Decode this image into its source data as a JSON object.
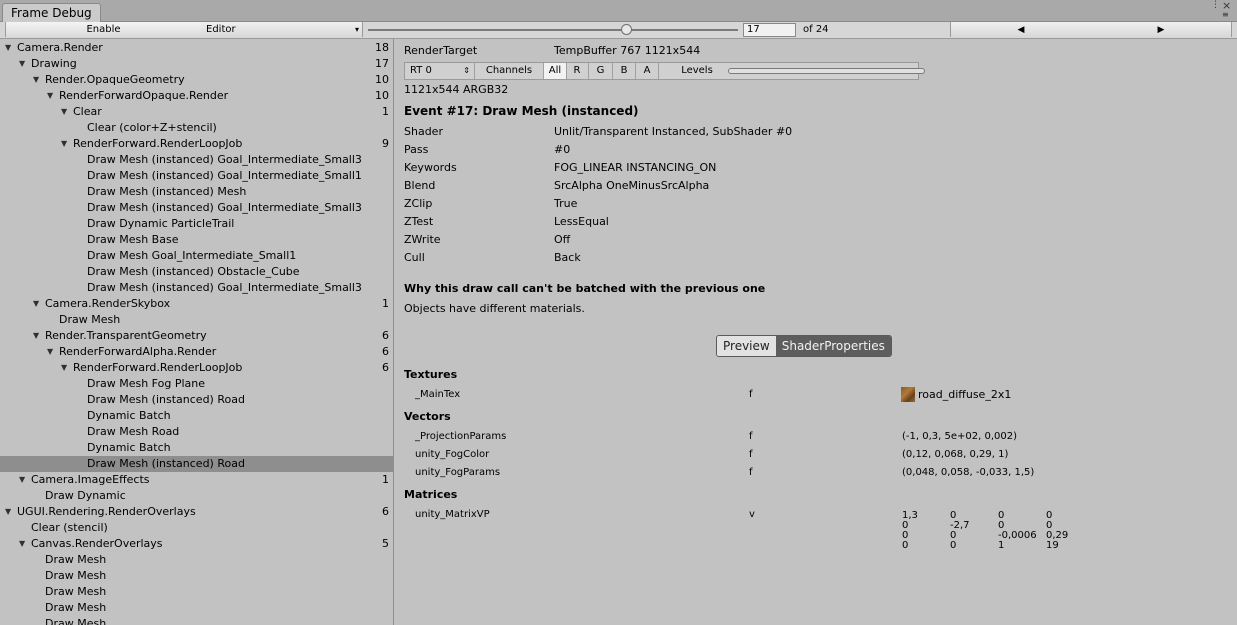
{
  "window": {
    "tab_title": "Frame Debug",
    "menu_icon": "kebab-menu-icon",
    "close_icon": "close-icon"
  },
  "toolbar": {
    "enable_label": "Enable",
    "editor_label": "Editor",
    "current_event": "17",
    "of_label": "of 24",
    "prev_symbol": "◀",
    "next_symbol": "▶",
    "slider_value": 17,
    "slider_max": 24
  },
  "tree": [
    {
      "label": "Camera.Render",
      "count": "18",
      "depth": 0,
      "expand": "open"
    },
    {
      "label": "Drawing",
      "count": "17",
      "depth": 1,
      "expand": "open"
    },
    {
      "label": "Render.OpaqueGeometry",
      "count": "10",
      "depth": 2,
      "expand": "open"
    },
    {
      "label": "RenderForwardOpaque.Render",
      "count": "10",
      "depth": 3,
      "expand": "open"
    },
    {
      "label": "Clear",
      "count": "1",
      "depth": 4,
      "expand": "open"
    },
    {
      "label": "Clear (color+Z+stencil)",
      "count": "",
      "depth": 5,
      "expand": "none"
    },
    {
      "label": "RenderForward.RenderLoopJob",
      "count": "9",
      "depth": 4,
      "expand": "open"
    },
    {
      "label": "Draw Mesh (instanced) Goal_Intermediate_Small3",
      "count": "",
      "depth": 5,
      "expand": "none"
    },
    {
      "label": "Draw Mesh (instanced) Goal_Intermediate_Small1",
      "count": "",
      "depth": 5,
      "expand": "none"
    },
    {
      "label": "Draw Mesh (instanced) Mesh",
      "count": "",
      "depth": 5,
      "expand": "none"
    },
    {
      "label": "Draw Mesh (instanced) Goal_Intermediate_Small3",
      "count": "",
      "depth": 5,
      "expand": "none"
    },
    {
      "label": "Draw Dynamic ParticleTrail",
      "count": "",
      "depth": 5,
      "expand": "none"
    },
    {
      "label": "Draw Mesh Base",
      "count": "",
      "depth": 5,
      "expand": "none"
    },
    {
      "label": "Draw Mesh Goal_Intermediate_Small1",
      "count": "",
      "depth": 5,
      "expand": "none"
    },
    {
      "label": "Draw Mesh (instanced) Obstacle_Cube",
      "count": "",
      "depth": 5,
      "expand": "none"
    },
    {
      "label": "Draw Mesh (instanced) Goal_Intermediate_Small3",
      "count": "",
      "depth": 5,
      "expand": "none"
    },
    {
      "label": "Camera.RenderSkybox",
      "count": "1",
      "depth": 2,
      "expand": "open"
    },
    {
      "label": "Draw Mesh",
      "count": "",
      "depth": 3,
      "expand": "none"
    },
    {
      "label": "Render.TransparentGeometry",
      "count": "6",
      "depth": 2,
      "expand": "open"
    },
    {
      "label": "RenderForwardAlpha.Render",
      "count": "6",
      "depth": 3,
      "expand": "open"
    },
    {
      "label": "RenderForward.RenderLoopJob",
      "count": "6",
      "depth": 4,
      "expand": "open"
    },
    {
      "label": "Draw Mesh Fog Plane",
      "count": "",
      "depth": 5,
      "expand": "none"
    },
    {
      "label": "Draw Mesh (instanced) Road",
      "count": "",
      "depth": 5,
      "expand": "none"
    },
    {
      "label": "Dynamic Batch",
      "count": "",
      "depth": 5,
      "expand": "none"
    },
    {
      "label": "Draw Mesh Road",
      "count": "",
      "depth": 5,
      "expand": "none"
    },
    {
      "label": "Dynamic Batch",
      "count": "",
      "depth": 5,
      "expand": "none"
    },
    {
      "label": "Draw Mesh (instanced) Road",
      "count": "",
      "depth": 5,
      "expand": "none",
      "selected": true
    },
    {
      "label": "Camera.ImageEffects",
      "count": "1",
      "depth": 1,
      "expand": "open"
    },
    {
      "label": "Draw Dynamic",
      "count": "",
      "depth": 2,
      "expand": "none"
    },
    {
      "label": "UGUI.Rendering.RenderOverlays",
      "count": "6",
      "depth": 0,
      "expand": "open"
    },
    {
      "label": "Clear (stencil)",
      "count": "",
      "depth": 1,
      "expand": "none"
    },
    {
      "label": "Canvas.RenderOverlays",
      "count": "5",
      "depth": 1,
      "expand": "open"
    },
    {
      "label": "Draw Mesh",
      "count": "",
      "depth": 2,
      "expand": "none"
    },
    {
      "label": "Draw Mesh",
      "count": "",
      "depth": 2,
      "expand": "none"
    },
    {
      "label": "Draw Mesh",
      "count": "",
      "depth": 2,
      "expand": "none"
    },
    {
      "label": "Draw Mesh",
      "count": "",
      "depth": 2,
      "expand": "none"
    },
    {
      "label": "Draw Mesh",
      "count": "",
      "depth": 2,
      "expand": "none"
    }
  ],
  "details": {
    "render_target_label": "RenderTarget",
    "render_target_value": "TempBuffer 767 1121x544",
    "rt_select": "RT 0",
    "channels_label": "Channels",
    "channels": [
      "All",
      "R",
      "G",
      "B",
      "A"
    ],
    "levels_label": "Levels",
    "format": "1121x544 ARGB32",
    "event_title": "Event #17: Draw Mesh (instanced)",
    "state": [
      {
        "key": "Shader",
        "value": "Unlit/Transparent Instanced, SubShader #0"
      },
      {
        "key": "Pass",
        "value": "#0"
      },
      {
        "key": "Keywords",
        "value": "FOG_LINEAR INSTANCING_ON"
      },
      {
        "key": "Blend",
        "value": "SrcAlpha OneMinusSrcAlpha"
      },
      {
        "key": "ZClip",
        "value": "True"
      },
      {
        "key": "ZTest",
        "value": "LessEqual"
      },
      {
        "key": "ZWrite",
        "value": "Off"
      },
      {
        "key": "Cull",
        "value": "Back"
      }
    ],
    "batch_heading": "Why this draw call can't be batched with the previous one",
    "batch_reason": "Objects have different materials.",
    "toggle_preview": "Preview",
    "toggle_props": "ShaderProperties",
    "textures_heading": "Textures",
    "textures": [
      {
        "name": "_MainTex",
        "type": "f",
        "value": "road_diffuse_2x1"
      }
    ],
    "vectors_heading": "Vectors",
    "vectors": [
      {
        "name": "_ProjectionParams",
        "type": "f",
        "value": "(-1, 0,3, 5e+02, 0,002)"
      },
      {
        "name": "unity_FogColor",
        "type": "f",
        "value": "(0,12, 0,068, 0,29, 1)"
      },
      {
        "name": "unity_FogParams",
        "type": "f",
        "value": "(0,048, 0,058, -0,033, 1,5)"
      }
    ],
    "matrices_heading": "Matrices",
    "matrix_name": "unity_MatrixVP",
    "matrix_type": "v",
    "matrix": [
      [
        "1,3",
        "0",
        "0",
        "0"
      ],
      [
        "0",
        "-2,7",
        "0",
        "0"
      ],
      [
        "0",
        "0",
        "-0,0006",
        "0,29"
      ],
      [
        "0",
        "0",
        "1",
        "19"
      ]
    ]
  }
}
